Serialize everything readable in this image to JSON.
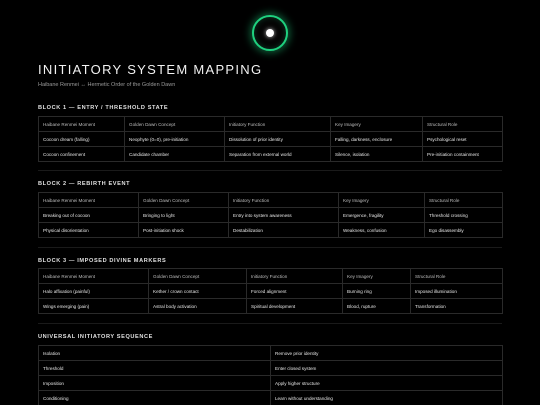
{
  "header": {
    "title": "INITIATORY SYSTEM MAPPING",
    "subtitle": "Haibane Renmei ↔ Hermetic Order of the Golden Dawn"
  },
  "blocks": [
    {
      "title": "BLOCK 1 — ENTRY / THRESHOLD STATE",
      "columns": [
        "Haibane Renmei Moment",
        "Golden Dawn Concept",
        "Initiatory Function",
        "Key Imagery",
        "Structural Role"
      ],
      "rows": [
        [
          "Cocoon dream (falling)",
          "Neophyte (0=0), pre-initiation",
          "Dissolution of prior identity",
          "Falling, darkness, enclosure",
          "Psychological reset"
        ],
        [
          "Cocoon confinement",
          "Candidate chamber",
          "Separation from external world",
          "Silence, isolation",
          "Pre-initiation containment"
        ]
      ]
    },
    {
      "title": "BLOCK 2 — REBIRTH EVENT",
      "columns": [
        "Haibane Renmei Moment",
        "Golden Dawn Concept",
        "Initiatory Function",
        "Key Imagery",
        "Structural Role"
      ],
      "rows": [
        [
          "Breaking out of cocoon",
          "Bringing to light",
          "Entry into system awareness",
          "Emergence, fragility",
          "Threshold crossing"
        ],
        [
          "Physical disorientation",
          "Post-initiation shock",
          "Destabilization",
          "Weakness, confusion",
          "Ego disassembly"
        ]
      ]
    },
    {
      "title": "BLOCK 3 — IMPOSED DIVINE MARKERS",
      "columns": [
        "Haibane Renmei Moment",
        "Golden Dawn Concept",
        "Initiatory Function",
        "Key Imagery",
        "Structural Role"
      ],
      "rows": [
        [
          "Halo affixation (painful)",
          "Kether / crown contact",
          "Forced alignment",
          "Burning ring",
          "Imposed illumination"
        ],
        [
          "Wings emerging (pain)",
          "Astral body activation",
          "Spiritual development",
          "Blood, rupture",
          "Transformation"
        ]
      ]
    }
  ],
  "sequence": {
    "title": "UNIVERSAL INITIATORY SEQUENCE",
    "rows": [
      [
        "Isolation",
        "Remove prior identity"
      ],
      [
        "Threshold",
        "Enter closed system"
      ],
      [
        "Imposition",
        "Apply higher structure"
      ],
      [
        "Conditioning",
        "Learn without understanding"
      ]
    ]
  }
}
